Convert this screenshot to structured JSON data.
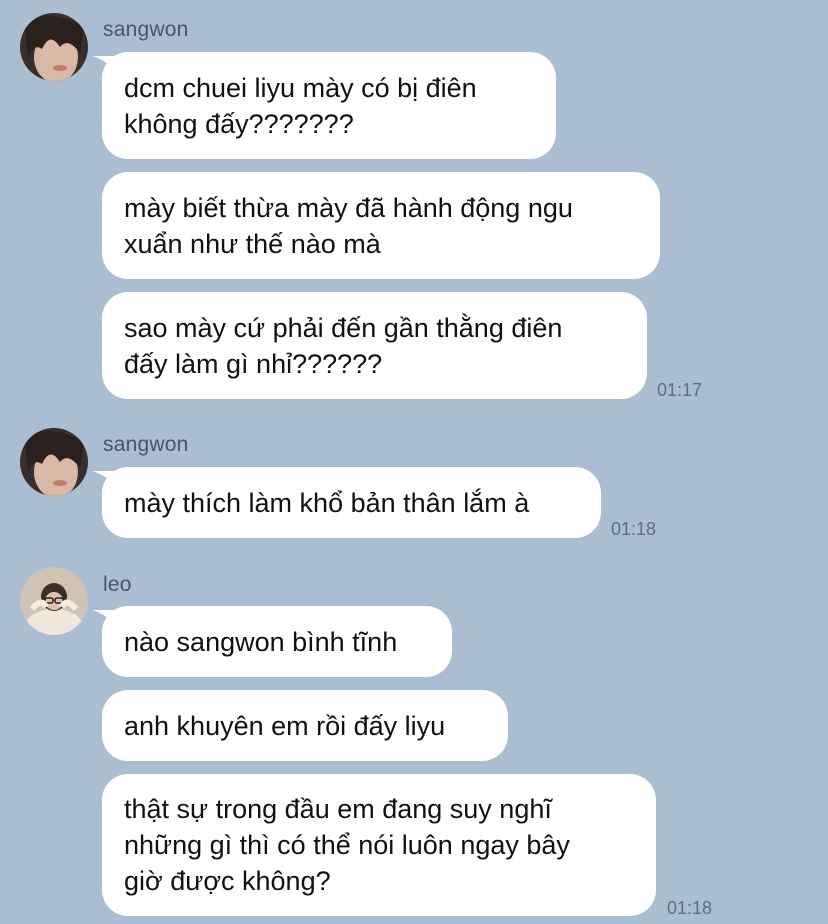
{
  "colors": {
    "background": "#a9bdd3",
    "bubble": "#ffffff",
    "text": "#111111",
    "sender": "#4b5563",
    "time": "#5d6f82"
  },
  "groups": [
    {
      "sender": "sangwon",
      "avatar": "sangwon-avatar",
      "messages": [
        {
          "lines": [
            "dcm chuei liyu mày có bị điên",
            "không đấy???????"
          ]
        },
        {
          "lines": [
            "mày biết thừa mày đã hành động ngu",
            "xuẩn như thế nào mà"
          ]
        },
        {
          "lines": [
            "sao mày cứ phải đến gần thằng điên",
            "đấy làm gì nhỉ??????"
          ],
          "time": "01:17"
        }
      ]
    },
    {
      "sender": "sangwon",
      "avatar": "sangwon-avatar",
      "messages": [
        {
          "lines": [
            "mày thích làm khổ bản thân lắm à"
          ],
          "time": "01:18"
        }
      ]
    },
    {
      "sender": "leo",
      "avatar": "leo-avatar",
      "messages": [
        {
          "lines": [
            "nào sangwon bình tĩnh"
          ]
        },
        {
          "lines": [
            "anh khuyên em rồi đấy liyu"
          ]
        },
        {
          "lines": [
            "thật sự trong đầu em đang suy nghĩ",
            "những gì thì có thể nói luôn ngay bây",
            "giờ được không?"
          ],
          "time": "01:18"
        }
      ]
    }
  ]
}
